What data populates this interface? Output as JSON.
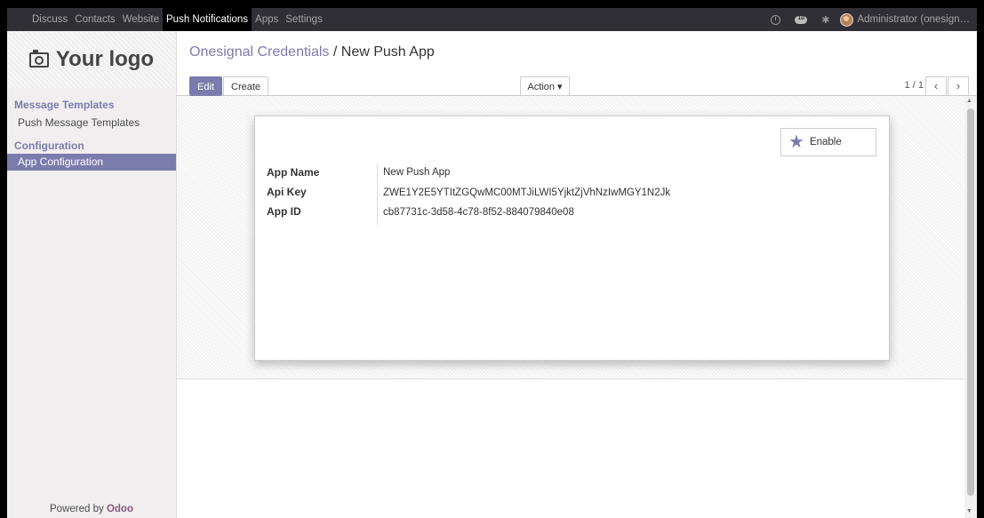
{
  "topbar": {
    "menus": [
      "Discuss",
      "Contacts",
      "Website",
      "Push Notifications",
      "Apps",
      "Settings"
    ],
    "active_menu": "Push Notifications",
    "chat_count": "10",
    "user": "Administrator (onesign…"
  },
  "sidebar": {
    "logo_text": "Your logo",
    "sections": [
      {
        "title": "Message Templates",
        "items": [
          "Push Message Templates"
        ]
      },
      {
        "title": "Configuration",
        "items": [
          "App Configuration"
        ]
      }
    ],
    "active_item": "App Configuration",
    "powered_prefix": "Powered by",
    "powered_brand": "Odoo"
  },
  "control_panel": {
    "breadcrumb_parent": "Onesignal Credentials",
    "breadcrumb_sep": "/",
    "breadcrumb_current": "New Push App",
    "edit_label": "Edit",
    "create_label": "Create",
    "action_label": "Action ▾",
    "pager": "1 / 1"
  },
  "form": {
    "enable_label": "Enable",
    "fields": [
      {
        "label": "App Name",
        "value": "New Push App"
      },
      {
        "label": "Api Key",
        "value": "ZWE1Y2E5YTItZGQwMC00MTJiLWI5YjktZjVhNzIwMGY1N2Jk"
      },
      {
        "label": "App ID",
        "value": "cb87731c-3d58-4c78-8f52-884079840e08"
      }
    ]
  },
  "colors": {
    "accent": "#7c7bad",
    "topbar_bg": "#2f2f35",
    "brand": "#875a7b"
  }
}
